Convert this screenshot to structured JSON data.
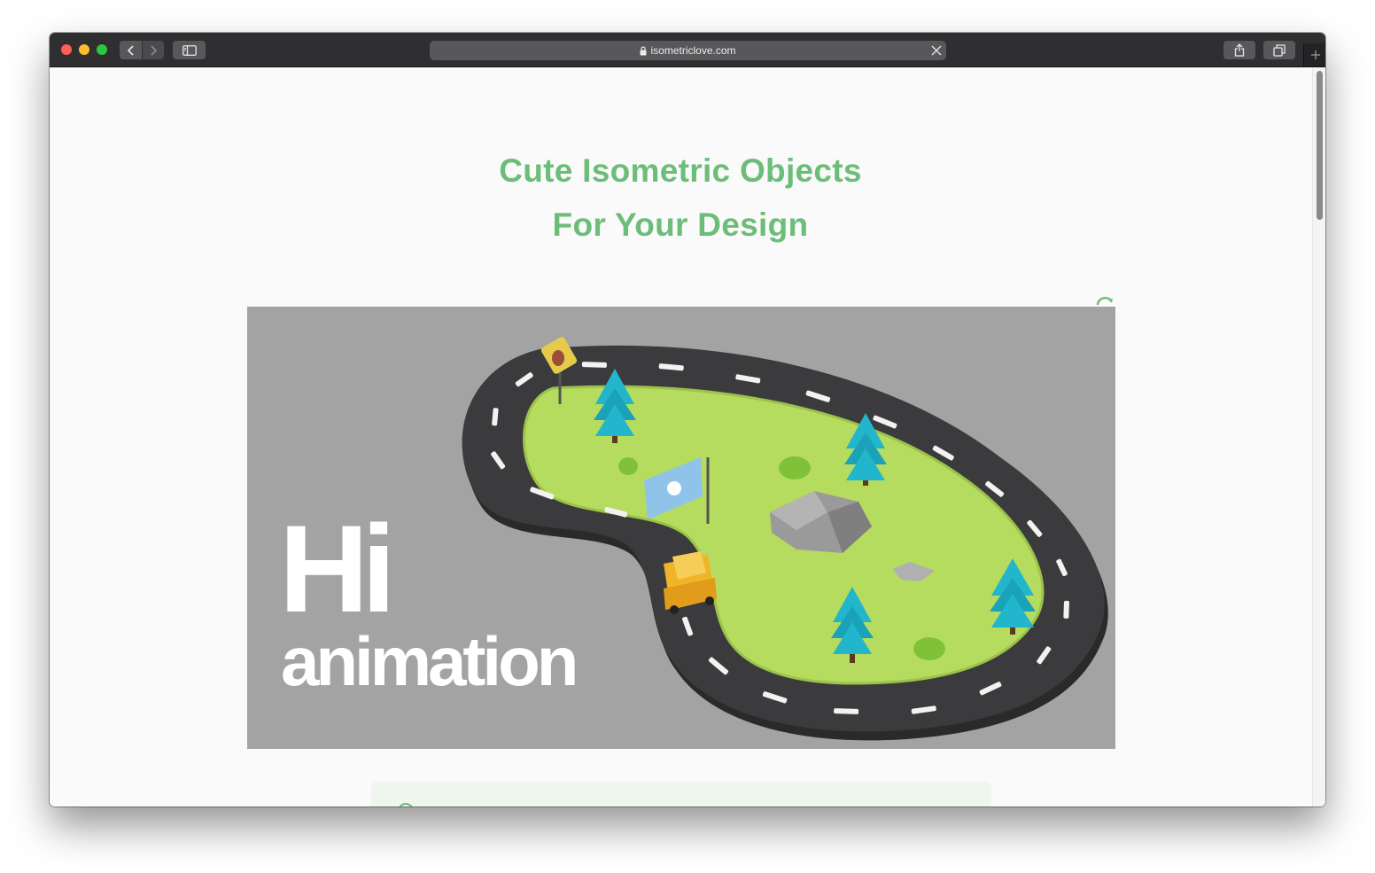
{
  "browser": {
    "url": "isometriclove.com"
  },
  "page": {
    "title_line1": "Cute Isometric Objects",
    "title_line2": "For Your Design"
  },
  "hero": {
    "big_word": "Hi",
    "sub_word": "animation"
  },
  "colors": {
    "accent": "#6cbd78",
    "toolbar": "#2f2f31",
    "hero_bg": "#a3a3a3",
    "grass": "#b5dc5e",
    "road": "#3a3a3a",
    "tree": "#1fb3c9"
  },
  "icons": {
    "refresh": "refresh-icon",
    "lock": "lock-icon"
  }
}
